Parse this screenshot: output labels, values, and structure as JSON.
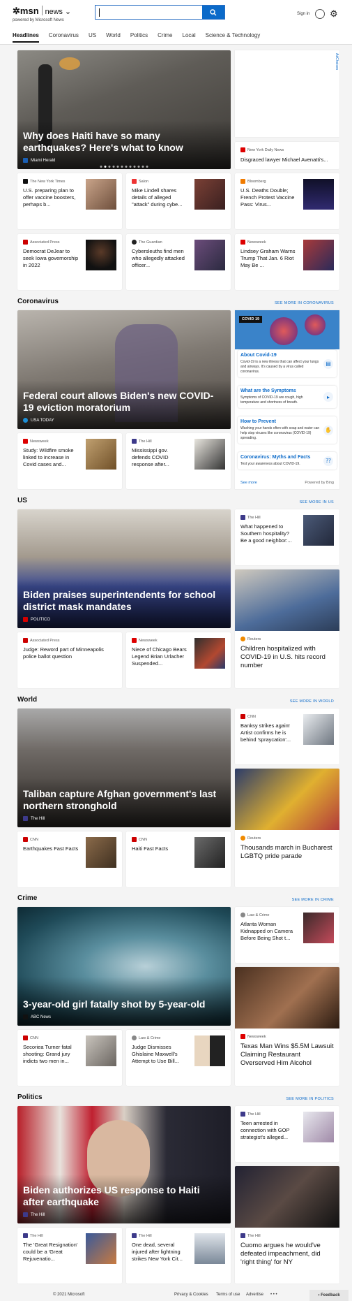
{
  "header": {
    "brand": "msn",
    "product": "news",
    "powered_by": "powered by Microsoft News",
    "sign_in": "Sign in"
  },
  "nav": [
    "Headlines",
    "Coronavirus",
    "US",
    "World",
    "Politics",
    "Crime",
    "Local",
    "Science & Technology"
  ],
  "ad": {
    "label": "AdChoices"
  },
  "top": {
    "hero": {
      "title": "Why does Haiti have so many earthquakes? Here's what to know",
      "source": "Miami Herald"
    },
    "side": {
      "source": "New York Daily News",
      "title": "Disgraced lawyer Michael Avenatti's..."
    },
    "row1": [
      {
        "source": "The New York Times",
        "title": "U.S. preparing plan to offer vaccine boosters, perhaps b..."
      },
      {
        "source": "Salon",
        "title": "Mike Lindell shares details of alleged \"attack\" during cybe..."
      },
      {
        "source": "Bloomberg",
        "title": "U.S. Deaths Double; French Protest Vaccine Pass: Virus..."
      }
    ],
    "row2": [
      {
        "source": "Associated Press",
        "title": "Democrat DeJear to seek Iowa governorship in 2022"
      },
      {
        "source": "The Guardian",
        "title": "Cybersleuths find men who allegedly attacked officer..."
      },
      {
        "source": "Newsweek",
        "title": "Lindsey Graham Warns Trump That Jan. 6 Riot May Be ..."
      }
    ]
  },
  "coronavirus": {
    "heading": "Coronavirus",
    "see_more": "SEE MORE IN CORONAVIRUS",
    "hero": {
      "title": "Federal court allows Biden's new COVID-19 eviction moratorium",
      "source": "USA TODAY"
    },
    "row": [
      {
        "source": "Newsweek",
        "title": "Study: Wildfire smoke linked to increase in Covid cases and..."
      },
      {
        "source": "The Hill",
        "title": "Mississippi gov. defends COVID response after..."
      }
    ],
    "widget": {
      "tag": "COVID 19",
      "items": [
        {
          "title": "About Covid-19",
          "text": "Covid-19 is a new illness that can affect your lungs and airways. It's caused by a virus called coronavirus."
        },
        {
          "title": "What are the Symptoms",
          "text": "Symptoms of COVID-19 are cough, high temperature and shortness of breath."
        },
        {
          "title": "How to Prevent",
          "text": "Washing your hands often with soap and water can help stop viruses like coronavirus (COVID-19) spreading."
        },
        {
          "title": "Coronavirus: Myths and Facts",
          "text": "Test your awareness about COVID-19."
        }
      ],
      "see_more": "See more",
      "powered": "Powered by Bing"
    }
  },
  "us": {
    "heading": "US",
    "see_more": "SEE MORE IN US",
    "hero": {
      "title": "Biden praises superintendents for school district mask mandates",
      "source": "POLITICO"
    },
    "side": {
      "source": "The Hill",
      "title": "What happened to Southern hospitality? Be a good neighbor:..."
    },
    "row": [
      {
        "source": "Associated Press",
        "title": "Judge: Reword part of Minneapolis police ballot question"
      },
      {
        "source": "Newsweek",
        "title": "Niece of Chicago Bears Legend Brian Urlacher Suspended..."
      }
    ],
    "big": {
      "source": "Reuters",
      "title": "Children hospitalized with COVID-19 in U.S. hits record number"
    }
  },
  "world": {
    "heading": "World",
    "see_more": "SEE MORE IN WORLD",
    "hero": {
      "title": "Taliban capture Afghan government's last northern stronghold",
      "source": "The Hill"
    },
    "side": {
      "source": "CNN",
      "title": "Banksy strikes again! Artist confirms he is behind 'spraycation'..."
    },
    "row": [
      {
        "source": "CNN",
        "title": "Earthquakes Fast Facts"
      },
      {
        "source": "CNN",
        "title": "Haiti Fast Facts"
      }
    ],
    "big": {
      "source": "Reuters",
      "title": "Thousands march in Bucharest LGBTQ pride parade"
    }
  },
  "crime": {
    "heading": "Crime",
    "see_more": "SEE MORE IN CRIME",
    "hero": {
      "title": "3-year-old girl fatally shot by 5-year-old",
      "source": "ABC News"
    },
    "side": {
      "source": "Law & Crime",
      "title": "Atlanta Woman Kidnapped on Camera Before Being Shot t..."
    },
    "row": [
      {
        "source": "CNN",
        "title": "Secoriea Turner fatal shooting: Grand jury indicts two men in..."
      },
      {
        "source": "Law & Crime",
        "title": "Judge Dismisses Ghislaine Maxwell's Attempt to Use Bill..."
      }
    ],
    "big": {
      "source": "Newsweek",
      "title": "Texas Man Wins $5.5M Lawsuit Claiming Restaurant Overserved Him Alcohol"
    }
  },
  "politics": {
    "heading": "Politics",
    "see_more": "SEE MORE IN POLITICS",
    "hero": {
      "title": "Biden authorizes US response to Haiti after earthquake",
      "source": "The Hill"
    },
    "side": {
      "source": "The Hill",
      "title": "Teen arrested in connection with GOP strategist's alleged..."
    },
    "row": [
      {
        "source": "The Hill",
        "title": "The 'Great Resignation' could be a 'Great Rejuvenatio..."
      },
      {
        "source": "The Hill",
        "title": "One dead, several injured after lightning strikes New York Cit..."
      }
    ],
    "big": {
      "source": "The Hill",
      "title": "Cuomo argues he would've defeated impeachment, did 'right thing' for NY"
    }
  },
  "footer": {
    "copyright": "© 2021 Microsoft",
    "links": [
      "Privacy & Cookies",
      "Terms of use",
      "Advertise"
    ],
    "more": "• • •",
    "feedback": "Feedback"
  }
}
